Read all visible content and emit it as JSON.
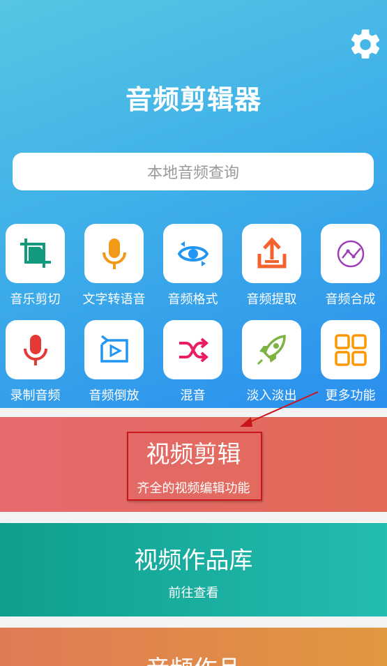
{
  "header": {
    "title": "音频剪辑器",
    "search_placeholder": "本地音频查询"
  },
  "tools": [
    {
      "label": "音乐剪切",
      "icon": "crop-icon",
      "color": "#139a7c"
    },
    {
      "label": "文字转语音",
      "icon": "microphone-icon",
      "color": "#f29a17"
    },
    {
      "label": "音频格式",
      "icon": "eye-rotate-icon",
      "color": "#2196f3"
    },
    {
      "label": "音频提取",
      "icon": "share-upload-icon",
      "color": "#f4622e"
    },
    {
      "label": "音频合成",
      "icon": "chart-circle-icon",
      "color": "#9c3fb4"
    },
    {
      "label": "录制音频",
      "icon": "record-mic-icon",
      "color": "#e53935"
    },
    {
      "label": "音频倒放",
      "icon": "reverse-play-icon",
      "color": "#2196f3"
    },
    {
      "label": "混音",
      "icon": "shuffle-icon",
      "color": "#e91e63"
    },
    {
      "label": "淡入淡出",
      "icon": "rocket-icon",
      "color": "#7cb342"
    },
    {
      "label": "更多功能",
      "icon": "grid-icon",
      "color": "#ff9800"
    }
  ],
  "cards": {
    "video_edit": {
      "title": "视频剪辑",
      "subtitle": "齐全的视频编辑功能"
    },
    "video_library": {
      "title": "视频作品库",
      "subtitle": "前往查看"
    },
    "audio_works": {
      "title": "音频作品"
    }
  },
  "annotation_color": "#c9161d"
}
